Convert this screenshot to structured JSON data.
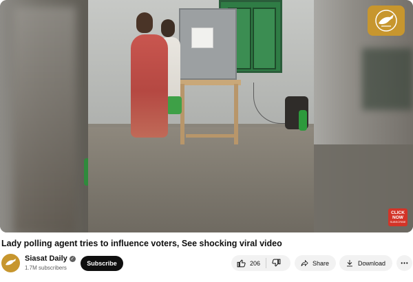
{
  "video": {
    "title": "Lady polling agent tries to influence voters, See shocking viral video",
    "overlay_badge": {
      "line1": "CLICK",
      "line2": "NOW",
      "line3": "SUBSCRIBE"
    }
  },
  "channel": {
    "name": "Siasat Daily",
    "subscribers": "1.7M subscribers",
    "verified": true,
    "watermark_icon": "dove-icon"
  },
  "actions": {
    "subscribe_label": "Subscribe",
    "like_count": "206",
    "share_label": "Share",
    "download_label": "Download"
  },
  "colors": {
    "accent_gold": "#c7962e",
    "subscribe_bg": "#0f0f0f",
    "pill_bg": "#f2f2f2",
    "badge_red": "#d33428"
  }
}
